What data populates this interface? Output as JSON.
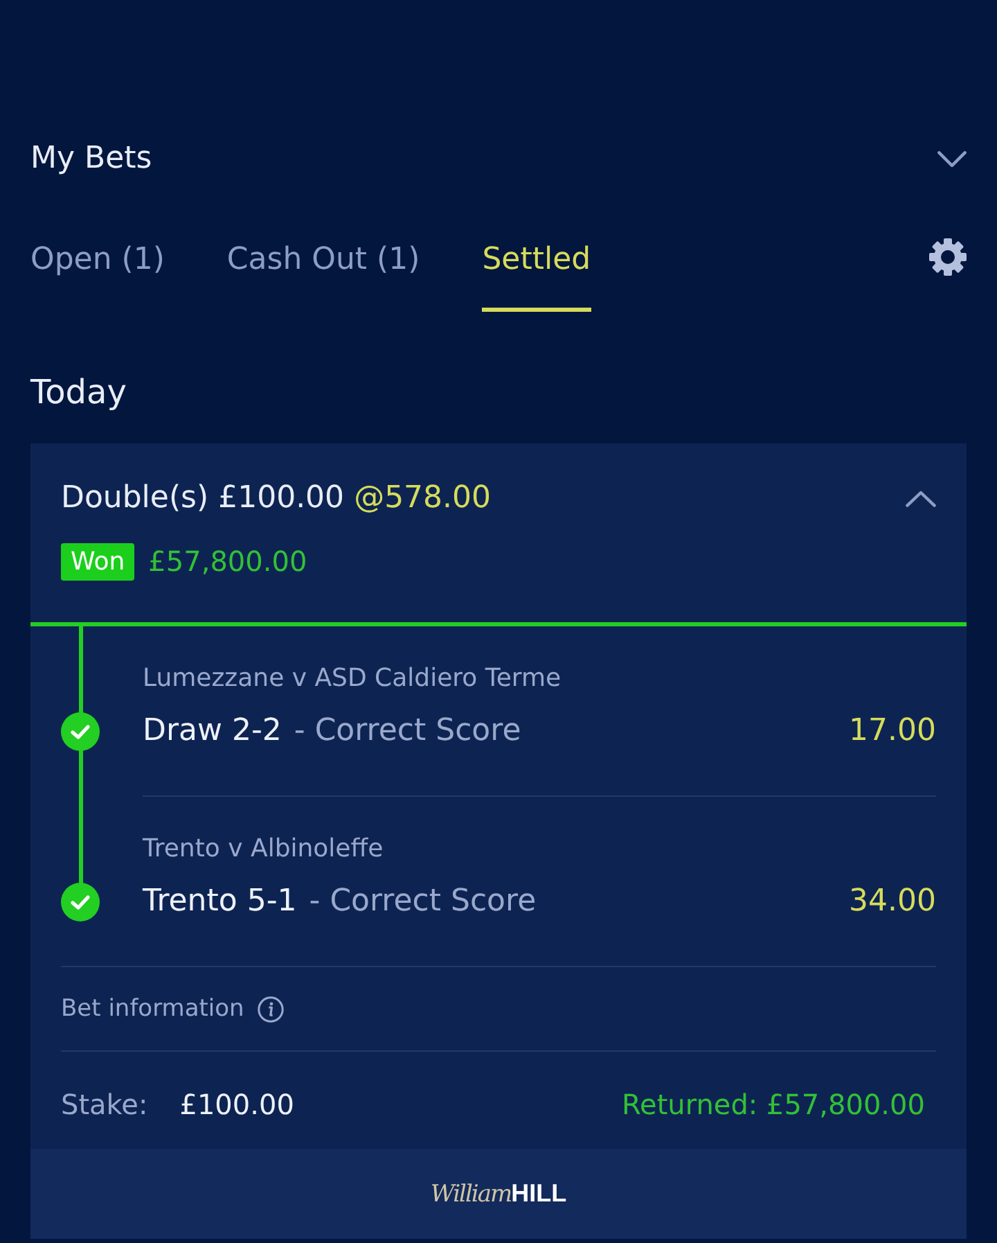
{
  "header": {
    "title": "My Bets"
  },
  "tabs": [
    {
      "label": "Open (1)",
      "selected": false
    },
    {
      "label": "Cash Out (1)",
      "selected": false
    },
    {
      "label": "Settled",
      "selected": true
    }
  ],
  "section_title": "Today",
  "bet": {
    "title": "Double(s) £100.00",
    "odds": "@578.00",
    "expanded": true,
    "won": true,
    "status_label": "Won",
    "return_amount": "£57,800.00",
    "legs": [
      {
        "event": "Lumezzane v ASD Caldiero Terme",
        "selection": "Draw 2-2",
        "market": "- Correct Score",
        "odds": "17.00",
        "won": true
      },
      {
        "event": "Trento v Albinoleffe",
        "selection": "Trento 5-1",
        "market": "- Correct Score",
        "odds": "34.00",
        "won": true
      }
    ],
    "info_label": "Bet information",
    "stake_label": "Stake:",
    "stake_value": "£100.00",
    "returned": "Returned: £57,800.00"
  },
  "footer": {
    "logo_script": "William",
    "logo_bold": "HILL"
  }
}
